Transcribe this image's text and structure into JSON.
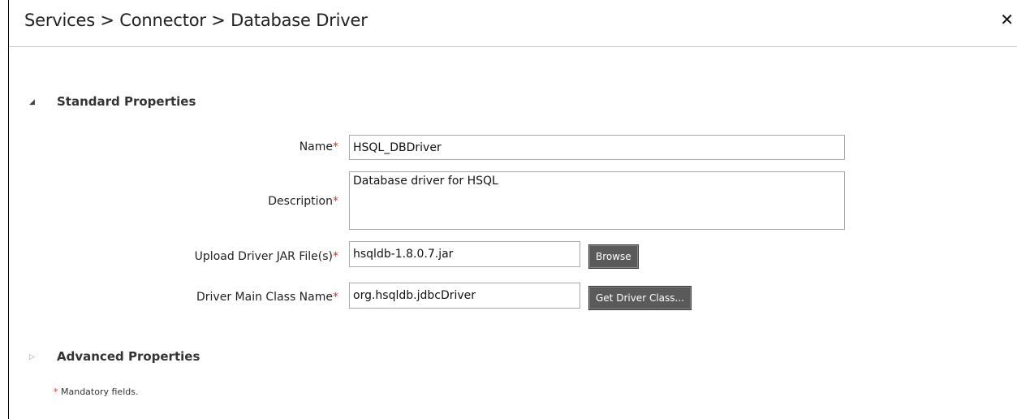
{
  "window": {
    "breadcrumb": "Services > Connector > Database Driver",
    "close_glyph": "✕"
  },
  "sections": {
    "standard": {
      "label": "Standard Properties",
      "expanded": true,
      "glyph": "◢"
    },
    "advanced": {
      "label": "Advanced Properties",
      "expanded": false,
      "glyph": "▷"
    }
  },
  "form": {
    "name": {
      "label": "Name",
      "required_marker": "*",
      "value": "HSQL_DBDriver"
    },
    "description": {
      "label": "Description",
      "required_marker": "*",
      "value": "Database driver for HSQL"
    },
    "upload_jar": {
      "label": "Upload Driver JAR File(s)",
      "required_marker": "*",
      "value": "hsqldb-1.8.0.7.jar",
      "button": "Browse"
    },
    "main_class": {
      "label": "Driver Main Class Name",
      "required_marker": "*",
      "value": "org.hsqldb.jdbcDriver",
      "button": "Get Driver Class..."
    }
  },
  "footer": {
    "required_marker": "*",
    "note": "Mandatory fields."
  },
  "colors": {
    "required": "#dd3322",
    "button_bg": "#5a5a5a"
  }
}
